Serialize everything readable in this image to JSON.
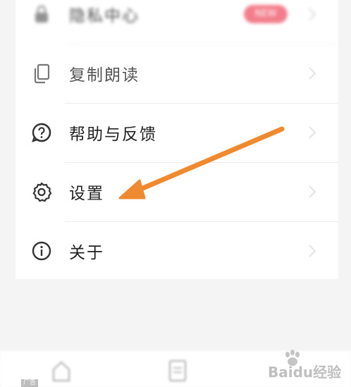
{
  "menu": {
    "items": [
      {
        "label": "隐私中心",
        "icon": "lock-icon",
        "badge": "NEW"
      },
      {
        "label": "复制朗读",
        "icon": "copy-icon"
      },
      {
        "label": "帮助与反馈",
        "icon": "help-icon"
      },
      {
        "label": "设置",
        "icon": "gear-icon"
      },
      {
        "label": "关于",
        "icon": "info-icon"
      }
    ]
  },
  "bottom": {
    "ad_tag": "广告",
    "watermark": "Baidu经验"
  },
  "colors": {
    "arrow": "#f08a30",
    "badge": "#ef5f6f",
    "icon": "#333333"
  }
}
